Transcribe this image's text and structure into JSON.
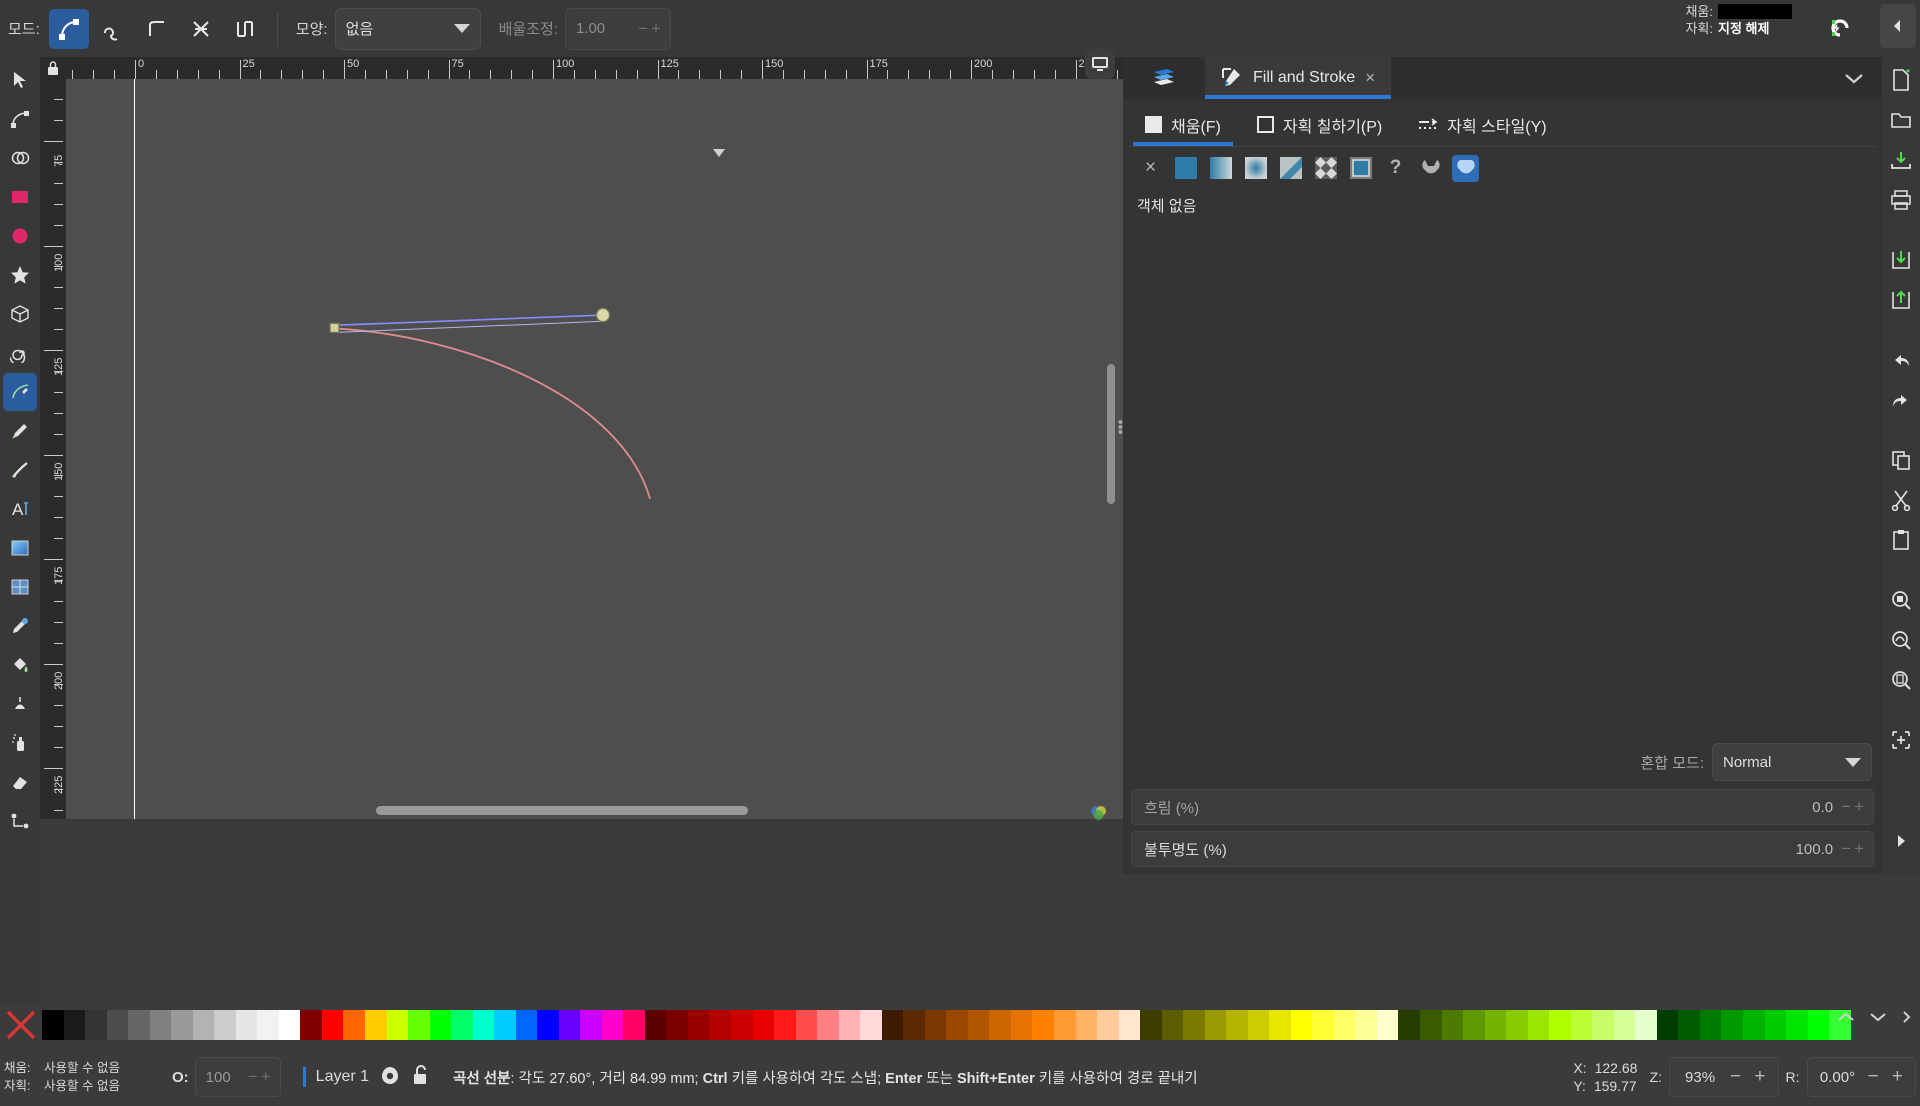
{
  "toolbar": {
    "mode_label": "모드:",
    "modes": [
      {
        "name": "bezier-mode",
        "active": true
      },
      {
        "name": "spiro-mode",
        "active": false
      },
      {
        "name": "bspline-mode",
        "active": false
      },
      {
        "name": "straight-line-mode",
        "active": false
      },
      {
        "name": "paraxial-mode",
        "active": false
      }
    ],
    "shape_label": "모양:",
    "shape_value": "없음",
    "scale_label": "배울조정:",
    "scale_value": "1.00"
  },
  "top_status": {
    "fill_label": "채움:",
    "fill_value": "",
    "stroke_label": "자획:",
    "stroke_value": "지정 해제"
  },
  "toolbox": {
    "tools": [
      {
        "name": "selector-tool",
        "active": false
      },
      {
        "name": "node-tool",
        "active": false
      },
      {
        "name": "shape-builder-tool",
        "active": false
      },
      {
        "name": "rectangle-tool",
        "active": false
      },
      {
        "name": "ellipse-tool",
        "active": false
      },
      {
        "name": "star-tool",
        "active": false
      },
      {
        "name": "3dbox-tool",
        "active": false
      },
      {
        "name": "spiral-tool",
        "active": false
      },
      {
        "name": "pen-bezier-tool",
        "active": true
      },
      {
        "name": "pencil-tool",
        "active": false
      },
      {
        "name": "calligraphy-tool",
        "active": false
      },
      {
        "name": "text-tool",
        "active": false
      },
      {
        "name": "gradient-tool",
        "active": false
      },
      {
        "name": "mesh-gradient-tool",
        "active": false
      },
      {
        "name": "dropper-tool",
        "active": false
      },
      {
        "name": "paint-bucket-tool",
        "active": false
      },
      {
        "name": "tweak-tool",
        "active": false
      },
      {
        "name": "spray-tool",
        "active": false
      },
      {
        "name": "eraser-tool",
        "active": false
      },
      {
        "name": "connector-tool",
        "active": false
      }
    ]
  },
  "rulers": {
    "h_ticks": [
      "0",
      "25",
      "50",
      "75",
      "100",
      "125",
      "150",
      "175",
      "200",
      "2"
    ],
    "v_ticks": [
      "75",
      "100",
      "125",
      "150",
      "175",
      "200",
      "225"
    ],
    "unit": "mm"
  },
  "dock": {
    "tabs": [
      {
        "label": "",
        "icon": "layers-icon",
        "active": false,
        "name": "tab-layers"
      },
      {
        "label": "Fill and Stroke",
        "icon": "fill-stroke-icon",
        "active": true,
        "name": "tab-fill-and-stroke",
        "close": "×"
      }
    ],
    "menu_icon": "chevron-down-icon"
  },
  "fill_stroke": {
    "subtabs": [
      {
        "label": "채움(F)",
        "icon": "filled-square-icon",
        "active": true
      },
      {
        "label": "자획 칠하기(P)",
        "icon": "outline-square-icon",
        "active": false
      },
      {
        "label": "자획 스타일(Y)",
        "icon": "stroke-style-icon",
        "active": false
      }
    ],
    "types": [
      {
        "name": "no-paint",
        "glyph": "×",
        "selected": false
      },
      {
        "name": "flat-color",
        "glyph": "",
        "selected": false
      },
      {
        "name": "linear-gradient",
        "glyph": "",
        "selected": false
      },
      {
        "name": "radial-gradient",
        "glyph": "",
        "selected": false
      },
      {
        "name": "mesh-gradient",
        "glyph": "",
        "selected": false
      },
      {
        "name": "pattern",
        "glyph": "",
        "selected": false
      },
      {
        "name": "swatch",
        "glyph": "",
        "selected": false
      },
      {
        "name": "unknown-paint",
        "glyph": "?",
        "selected": false
      },
      {
        "name": "unset-paint",
        "glyph": "",
        "selected": false
      },
      {
        "name": "inherited-paint",
        "glyph": "",
        "selected": true
      }
    ],
    "message": "객체 없음",
    "blend_label": "혼합 모드:",
    "blend_value": "Normal",
    "blur": {
      "label": "흐림 (%)",
      "value": "0.0"
    },
    "opacity": {
      "label": "불투명도 (%)",
      "value": "100.0"
    }
  },
  "commands": {
    "items": [
      {
        "name": "new-document-icon"
      },
      {
        "name": "open-document-icon"
      },
      {
        "name": "save-document-icon"
      },
      {
        "name": "print-icon"
      },
      {
        "name": "import-icon"
      },
      {
        "name": "export-icon"
      },
      {
        "name": "undo-icon"
      },
      {
        "name": "redo-icon"
      },
      {
        "name": "copy-icon"
      },
      {
        "name": "cut-icon"
      },
      {
        "name": "paste-icon"
      },
      {
        "name": "duplicate-icon"
      },
      {
        "name": "zoom-selection-icon"
      },
      {
        "name": "zoom-drawing-icon"
      },
      {
        "name": "zoom-page-icon"
      },
      {
        "name": "group-icon"
      },
      {
        "name": "next-icon"
      }
    ]
  },
  "palette": {
    "colors": [
      "#000000",
      "#1a1a1a",
      "#333333",
      "#4d4d4d",
      "#666666",
      "#808080",
      "#999999",
      "#b3b3b3",
      "#cccccc",
      "#e6e6e6",
      "#f2f2f2",
      "#ffffff",
      "#800000",
      "#ff0000",
      "#ff6600",
      "#ffcc00",
      "#ccff00",
      "#66ff00",
      "#00ff00",
      "#00ff66",
      "#00ffcc",
      "#00ccff",
      "#0066ff",
      "#0000ff",
      "#6600ff",
      "#cc00ff",
      "#ff00cc",
      "#ff0066",
      "#5c0000",
      "#7a0000",
      "#990000",
      "#b30000",
      "#cc0000",
      "#e60000",
      "#ff1a1a",
      "#ff4d4d",
      "#ff8080",
      "#ffb3b3",
      "#ffd9d9",
      "#3d1a00",
      "#5c2900",
      "#7a3800",
      "#994700",
      "#b35600",
      "#cc6600",
      "#e67300",
      "#ff8000",
      "#ff9933",
      "#ffb366",
      "#ffcc99",
      "#ffe6cc",
      "#3d3d00",
      "#5c5c00",
      "#7a7a00",
      "#999900",
      "#b3b300",
      "#cccc00",
      "#e6e600",
      "#ffff00",
      "#ffff33",
      "#ffff66",
      "#ffff99",
      "#ffffcc",
      "#263d00",
      "#3a5c00",
      "#4d7a00",
      "#619900",
      "#75b300",
      "#88cc00",
      "#9ce600",
      "#b0ff00",
      "#bbff33",
      "#c9ff66",
      "#d6ff99",
      "#e4ffcc",
      "#003d00",
      "#005c00",
      "#007a00",
      "#009900",
      "#00b300",
      "#00cc00",
      "#00e600",
      "#00ff00",
      "#33ff33"
    ],
    "no_color_icon": "no-color-x-icon"
  },
  "status": {
    "fill_label": "채움:",
    "fill_value": "사용할 수 없음",
    "stroke_label": "자획:",
    "stroke_value": "사용할 수 없음",
    "opacity_label": "O:",
    "opacity_value": "100",
    "layer_name": "Layer 1",
    "hint_prefix": "곡선 선분",
    "hint_text": ": 각도 27.60°, 거리 84.99 mm; ",
    "hint_b1": "Ctrl",
    "hint_t1": " 키를 사용하여 각도 스냅; ",
    "hint_b2": "Enter",
    "hint_t2": " 또는 ",
    "hint_b3": "Shift+Enter",
    "hint_t3": " 키를 사용하여 경로 끝내기",
    "x_label": "X:",
    "x_value": "122.68",
    "y_label": "Y:",
    "y_value": "159.77",
    "zoom_label": "Z:",
    "zoom_value": "93%",
    "rotate_label": "R:",
    "rotate_value": "0.00°"
  },
  "colors": {
    "accent": "#2b79d4",
    "panel_bg": "#343434",
    "canvas_bg": "#4e4e4e",
    "chrome": "#383838",
    "path_stroke": "#e08b8b",
    "handle_line": "#8a8aff"
  }
}
